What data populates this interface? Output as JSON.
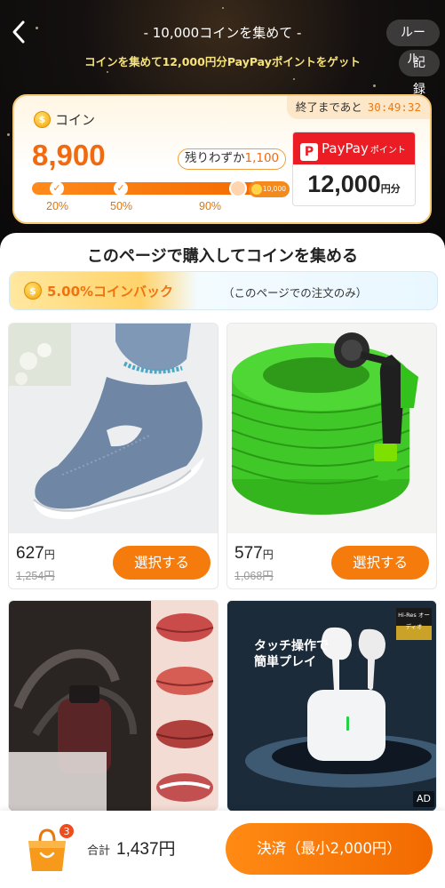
{
  "header": {
    "back_icon": "chevron-left-icon",
    "title": "- 10,000コインを集めて -",
    "subtitle": "コインを集めて12,000円分PayPayポイントをゲット",
    "rules_label": "ルール",
    "history_label": "記録"
  },
  "coin_card": {
    "countdown_label": "終了まであと",
    "countdown_time": "30:49:32",
    "coin_icon": "coin-icon",
    "coin_label": "コイン",
    "coin_value": "8,900",
    "remaining_label": "残りわずか",
    "remaining_value": "1,100",
    "progress_fraction": 0.89,
    "goal_value": "10,000",
    "milestones": [
      "20%",
      "50%",
      "90%"
    ],
    "reward": {
      "brand": "PayPay",
      "brand_suffix": "ポイント",
      "amount": "12,000",
      "unit": "円分",
      "brand_color": "#ec1c24"
    }
  },
  "section": {
    "title": "このページで購入してコインを集める",
    "cashback": "5.00%コインバック",
    "cashback_note": "（このページでの注文のみ）"
  },
  "products": [
    {
      "price": "627",
      "currency": "円",
      "original_price": "1,254円",
      "button": "選択する",
      "image": "blue-knit-shoes"
    },
    {
      "price": "577",
      "currency": "円",
      "original_price": "1,068円",
      "button": "選択する",
      "image": "green-garden-hose"
    },
    {
      "image": "lip-tint-bottles"
    },
    {
      "image": "white-wireless-earbuds",
      "image_caption": "タッチ操作で簡単プレイ",
      "image_tag": "Hi-Res オーディオ",
      "ad_label": "AD"
    }
  ],
  "footer": {
    "cart_count": "3",
    "total_label": "合計",
    "total_value": "1,437円",
    "checkout_label": "決済（最小2,000円）"
  },
  "colors": {
    "accent": "#f57c0c",
    "paypay_red": "#ec1c24",
    "coin_orange": "#f26a10"
  }
}
